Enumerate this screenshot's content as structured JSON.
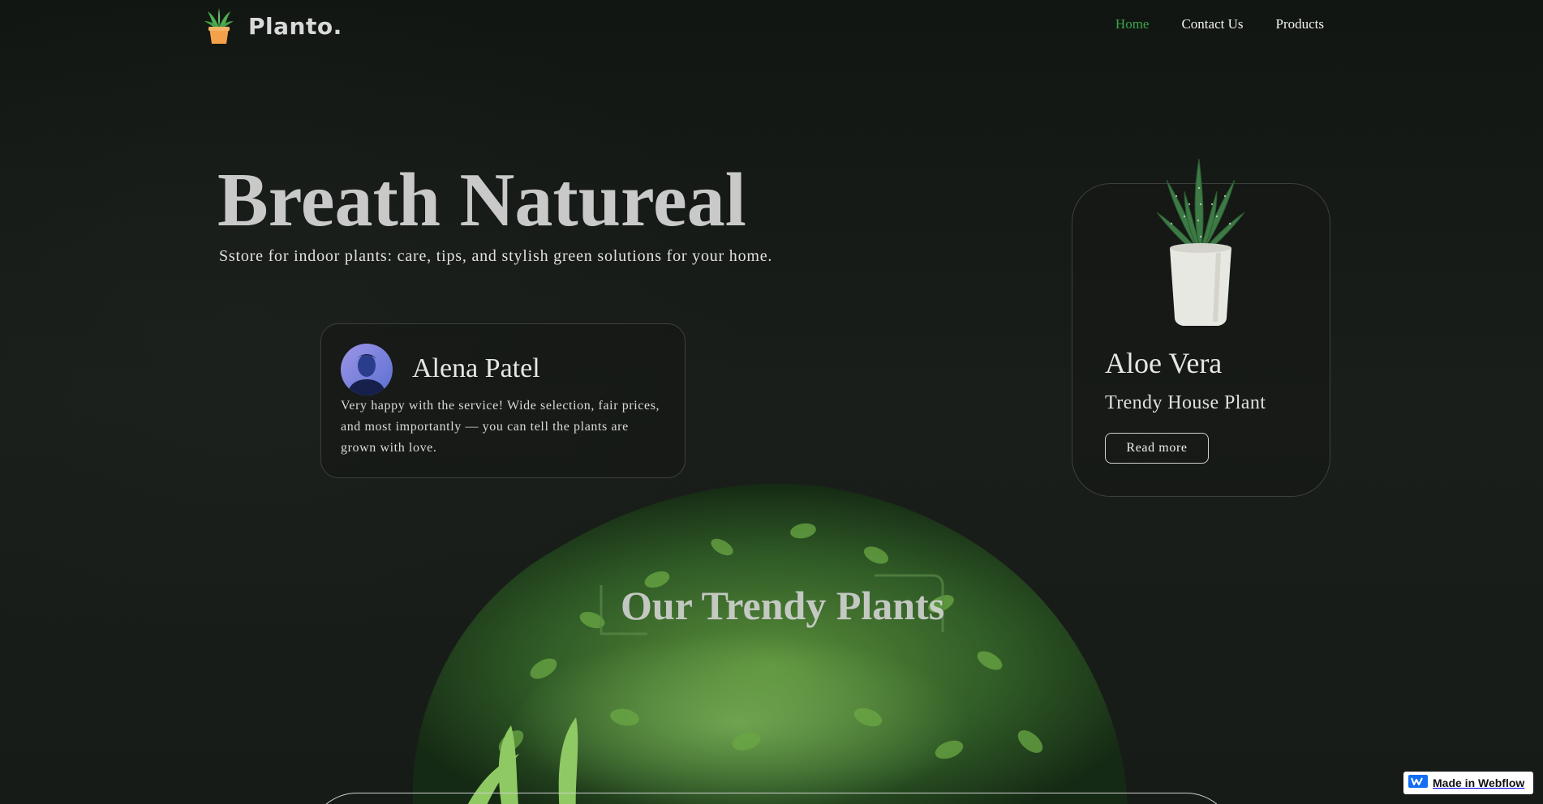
{
  "header": {
    "brand": "Planto.",
    "nav": [
      {
        "label": "Home",
        "active": true
      },
      {
        "label": "Contact Us",
        "active": false
      },
      {
        "label": "Products",
        "active": false
      }
    ]
  },
  "hero": {
    "title": "Breath Natureal",
    "subtitle": "Sstore for indoor plants: care, tips, and stylish green solutions for your home."
  },
  "testimonial": {
    "name": "Alena Patel",
    "text": "Very happy with the service! Wide selection, fair prices, and most importantly — you can tell the plants are grown with love."
  },
  "product": {
    "name": "Aloe Vera",
    "category": "Trendy House Plant",
    "cta": "Read more"
  },
  "section": {
    "title": "Our Trendy Plants"
  },
  "badge": {
    "label": "Made in Webflow"
  },
  "colors": {
    "accent": "#3aa84a",
    "background": "#141814",
    "text": "#e6e6e6"
  },
  "icons": {
    "logo": "potted-plant-icon",
    "badge": "webflow-logo-icon"
  }
}
